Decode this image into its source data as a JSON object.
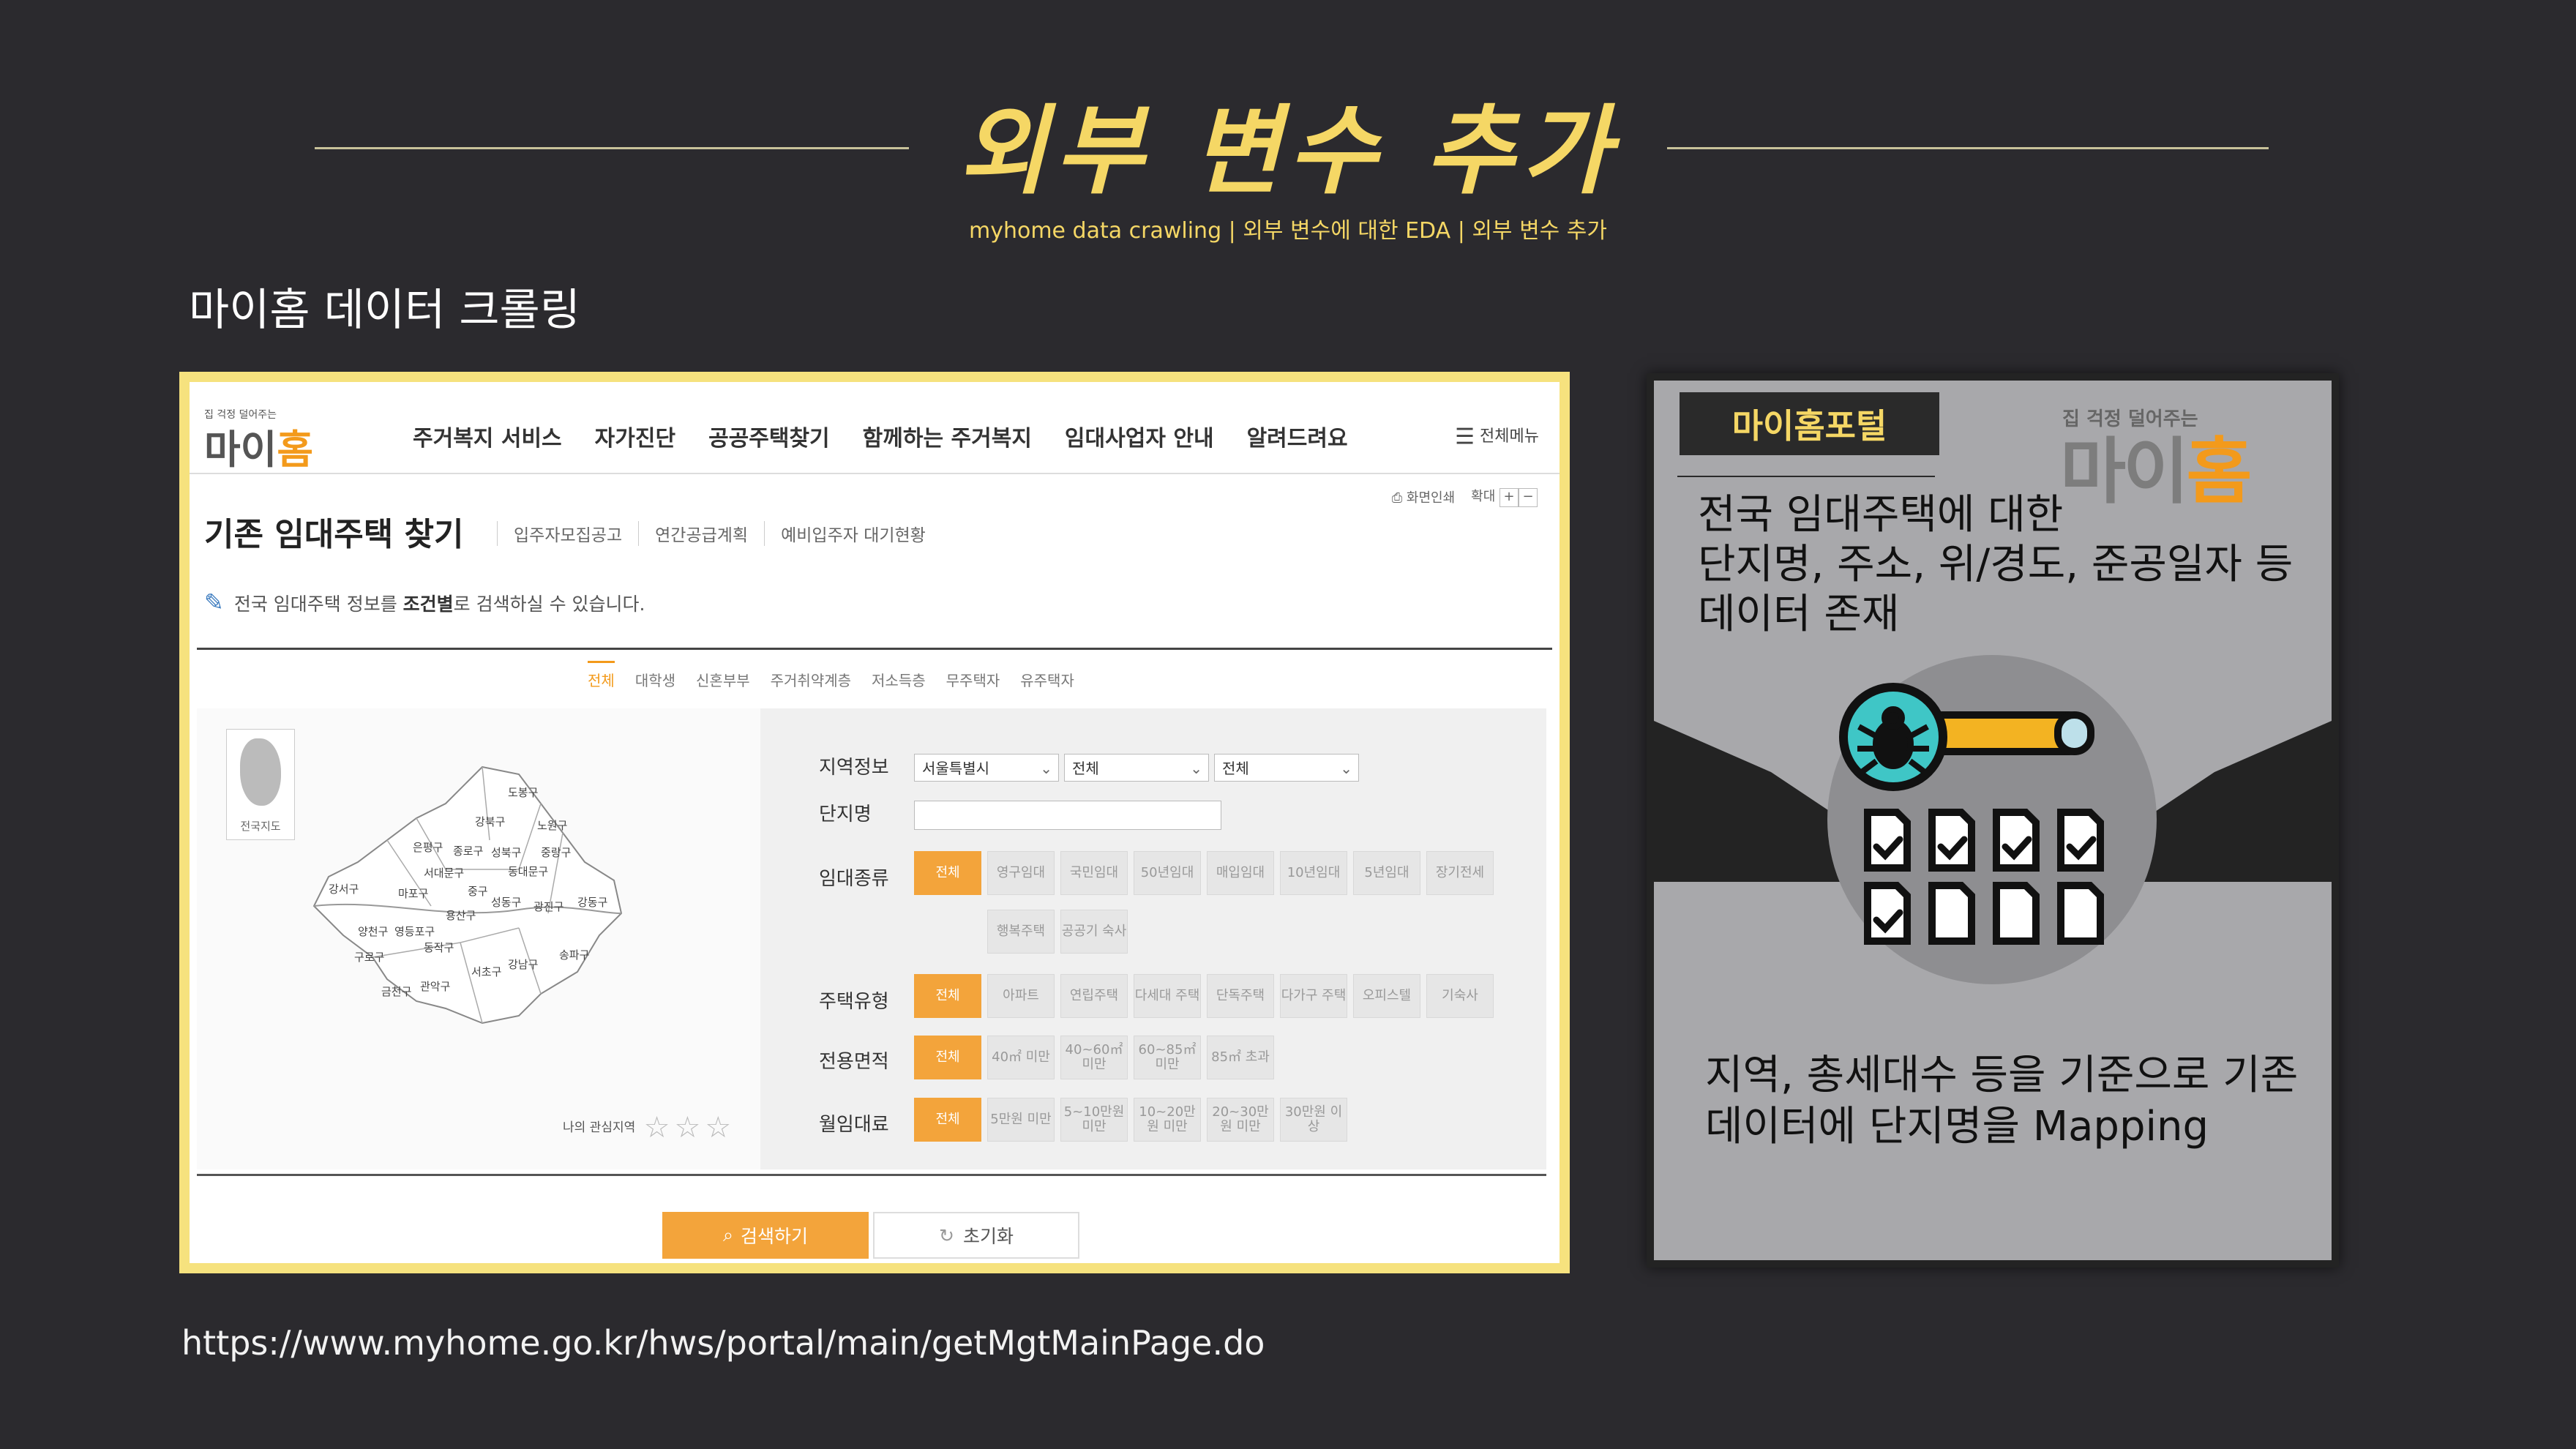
{
  "slide": {
    "title": "외부 변수 추가",
    "subtitle": "myhome data crawling | 외부 변수에 대한 EDA | 외부 변수 추가",
    "section_label": "마이홈 데이터 크롤링",
    "url": "https://www.myhome.go.kr/hws/portal/main/getMgtMainPage.do"
  },
  "site": {
    "logo_tagline": "집 걱정 덜어주는",
    "logo_text_a": "마이",
    "logo_text_b": "홈",
    "gnb": [
      "주거복지 서비스",
      "자가진단",
      "공공주택찾기",
      "함께하는 주거복지",
      "임대사업자 안내",
      "알려드려요"
    ],
    "all_menu": "전체메뉴",
    "util_print": "화면인쇄",
    "util_zoom": "확대",
    "page_heading": "기존 임대주택 찾기",
    "sub_tabs": [
      "입주자모집공고",
      "연간공급계획",
      "예비입주자 대기현황"
    ],
    "notice_pre": "전국 임대주택 정보를 ",
    "notice_bold": "조건별",
    "notice_post": "로 검색하실 수 있습니다.",
    "category_tabs": [
      "전체",
      "대학생",
      "신혼부부",
      "주거취약계층",
      "저소득층",
      "무주택자",
      "유주택자"
    ],
    "mini_map_label": "전국지도",
    "districts": [
      "도봉구",
      "강북구",
      "노원구",
      "은평구",
      "종로구",
      "성북구",
      "중랑구",
      "서대문구",
      "동대문구",
      "강서구",
      "마포구",
      "중구",
      "성동구",
      "광진구",
      "강동구",
      "용산구",
      "양천구",
      "영등포구",
      "동작구",
      "구로구",
      "송파구",
      "서초구",
      "강남구",
      "관악구",
      "금천구"
    ],
    "favorite_label": "나의 관심지역",
    "form": {
      "region_label": "지역정보",
      "region_selects": [
        "서울특별시",
        "전체",
        "전체"
      ],
      "complex_label": "단지명",
      "complex_value": "",
      "rent_type_label": "임대종류",
      "rent_types": [
        "전체",
        "영구임대",
        "국민임대",
        "50년임대",
        "매입임대",
        "10년임대",
        "5년임대",
        "장기전세",
        "행복주택",
        "공공기 숙사"
      ],
      "house_type_label": "주택유형",
      "house_types": [
        "전체",
        "아파트",
        "연립주택",
        "다세대 주택",
        "단독주택",
        "다가구 주택",
        "오피스텔",
        "기숙사"
      ],
      "area_label": "전용면적",
      "areas": [
        "전체",
        "40㎡ 미만",
        "40~60㎡ 미만",
        "60~85㎡ 미만",
        "85㎡ 초과"
      ],
      "rent_label": "월임대료",
      "rents": [
        "전체",
        "5만원 미만",
        "5~10만원 미만",
        "10~20만원 미만",
        "20~30만원 미만",
        "30만원 이상"
      ]
    },
    "search_button": "검색하기",
    "reset_button": "초기화"
  },
  "card": {
    "badge": "마이홈포털",
    "brand_small": "집 걱정 덜어주는",
    "brand_a": "마이",
    "brand_b": "홈",
    "text_top_1": "전국 임대주택에 대한",
    "text_top_2": "단지명, 주소, 위/경도, 준공일자 등",
    "text_top_3": "데이터 존재",
    "text_bottom_1": "지역, 총세대수 등을 기준으로 기존",
    "text_bottom_2": "데이터에 단지명을 Mapping"
  },
  "colors": {
    "background": "#2b2a2e",
    "accent_yellow": "#f5d765",
    "accent_orange": "#f3a43b",
    "card_gray": "#a8a8ab"
  }
}
